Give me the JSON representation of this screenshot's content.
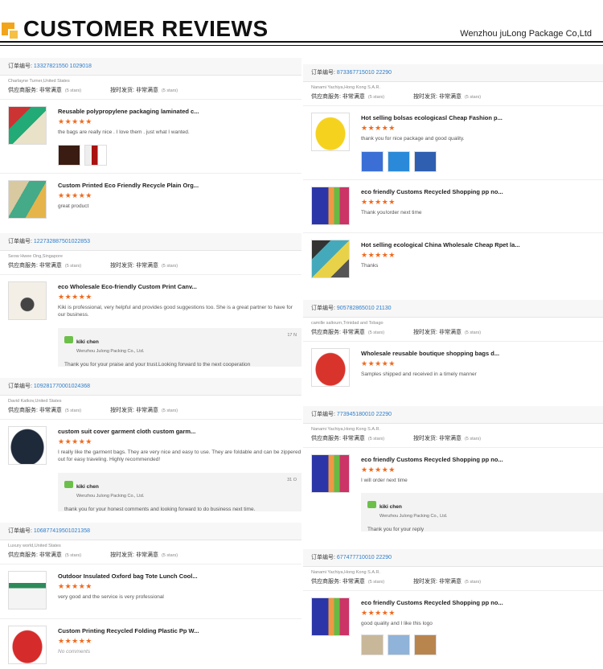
{
  "header": {
    "title": "CUSTOMER REVIEWS",
    "company": "Wenzhou juLong Package Co,Ltd"
  },
  "labels": {
    "order": "订单编号:",
    "service": "供应商服务: 非常满意",
    "delivery": "按时发货: 非常满意",
    "stars_text": "(5 stars)",
    "stars": "★★★★★",
    "reply_name": "kiki chen",
    "reply_company": "Wenzhou Julong Packing Co., Ltd."
  },
  "left": [
    {
      "order": "13327821550 1029018",
      "customer": "Charlayne Turner,United States",
      "items": [
        {
          "title": "Reusable polypropylene packaging laminated c...",
          "comment": "the bags are really nice . I love them . just what I wanted."
        },
        {
          "title": "Custom Printed Eco Friendly Recycle Plain Org...",
          "comment": "great product"
        }
      ]
    },
    {
      "order": "122732887501022853",
      "customer": "Seow Hwee Ong,Singapore",
      "items": [
        {
          "title": "eco Wholesale Eco-friendly Custom Print Canv...",
          "comment": "Kiki is professional, very helpful and provides good suggestions too.  She is a great partner to have for our business.",
          "reply": "Thank you for your praise and your trust.Looking forward to the next cooperation",
          "reply_date": "17 N"
        }
      ]
    },
    {
      "order": "109281770001024368",
      "customer": "David Katkov,United States",
      "items": [
        {
          "title": "custom suit cover garment cloth custom garm...",
          "comment": "I really like the garment bags. They are very nice and easy to use. They are foldable and can be zippered out for easy traveling. Highly recommended!",
          "reply": "thank  you for your honest comments and looking forward to do business next time.",
          "reply_date": "31 O"
        }
      ]
    },
    {
      "order": "106877419501021358",
      "customer": "Luxury world,United States",
      "items": [
        {
          "title": "Outdoor Insulated Oxford bag Tote Lunch Cool...",
          "comment": "very good and the service is very professional"
        },
        {
          "title": "Custom Printing Recycled Folding Plastic Pp W...",
          "comment": "No comments"
        }
      ]
    }
  ],
  "right": [
    {
      "order": "873367715010 22290",
      "customer": "Nanami Yachiya,Hong Kong S.A.R.",
      "items": [
        {
          "title": "Hot selling bolsas ecologicasl Cheap Fashion p...",
          "comment": "thank you for nice package and good quality."
        },
        {
          "title": "eco friendly Customs Recycled Shopping pp no...",
          "comment": "Thank you!order next time"
        },
        {
          "title": "Hot selling ecological China Wholesale Cheap Rpet la...",
          "comment": "Thanks"
        }
      ]
    },
    {
      "order": "905782865010 21130",
      "customer": "camille saltourn,Trinidad and Tobago",
      "items": [
        {
          "title": "Wholesale reusable boutique shopping bags d...",
          "comment": "Samples shipped and received in a timely manner"
        }
      ]
    },
    {
      "order": "773945180010 22290",
      "customer": "Nanami Yachiya,Hong Kong S.A.R.",
      "items": [
        {
          "title": "eco friendly Customs Recycled Shopping pp no...",
          "comment": "I will order next time",
          "reply": "Thank you for your reply"
        }
      ]
    },
    {
      "order": "677477710010 22290",
      "customer": "Nanami Yachiya,Hong Kong S.A.R.",
      "items": [
        {
          "title": "eco friendly Customs Recycled Shopping pp no...",
          "comment": "good quality and I like this logo"
        }
      ]
    }
  ]
}
